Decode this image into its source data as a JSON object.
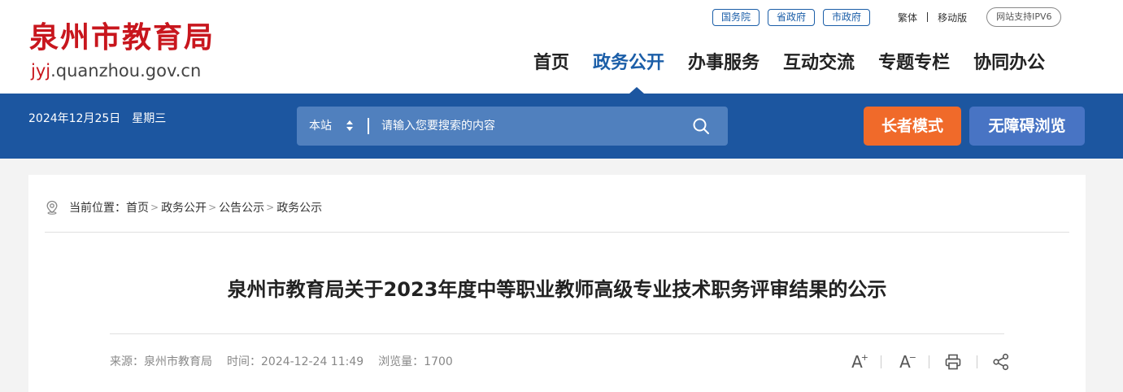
{
  "site": {
    "logo_name": "泉州市教育局",
    "logo_url_prefix": "jyj",
    "logo_url_suffix": ".quanzhou.gov.cn"
  },
  "top_links": {
    "pills": [
      "国务院",
      "省政府",
      "市政府"
    ],
    "traditional": "繁体",
    "mobile": "移动版",
    "ipv6": "网站支持IPV6"
  },
  "nav": {
    "items": [
      "首页",
      "政务公开",
      "办事服务",
      "互动交流",
      "专题专栏",
      "协同办公"
    ],
    "active_index": 1
  },
  "bar": {
    "date": "2024年12月25日",
    "weekday": "星期三",
    "search_scope": "本站",
    "search_placeholder": "请输入您要搜索的内容",
    "elder_mode": "长者模式",
    "accessible": "无障碍浏览"
  },
  "breadcrumb": {
    "label": "当前位置：",
    "items": [
      "首页",
      "政务公开",
      "公告公示",
      "政务公示"
    ],
    "separator": ">"
  },
  "article": {
    "title": "泉州市教育局关于2023年度中等职业教师高级专业技术职务评审结果的公示",
    "source": "来源：泉州市教育局",
    "time": "时间：2024-12-24 11:49",
    "views": "浏览量：1700"
  },
  "tools": {
    "font_large": "A",
    "font_large_mark": "+",
    "font_small": "A",
    "font_small_mark": "−"
  },
  "colors": {
    "brand_red": "#c8161d",
    "brand_blue": "#1c56a0",
    "elder_orange": "#f06a2a",
    "access_blue": "#4874c4"
  }
}
